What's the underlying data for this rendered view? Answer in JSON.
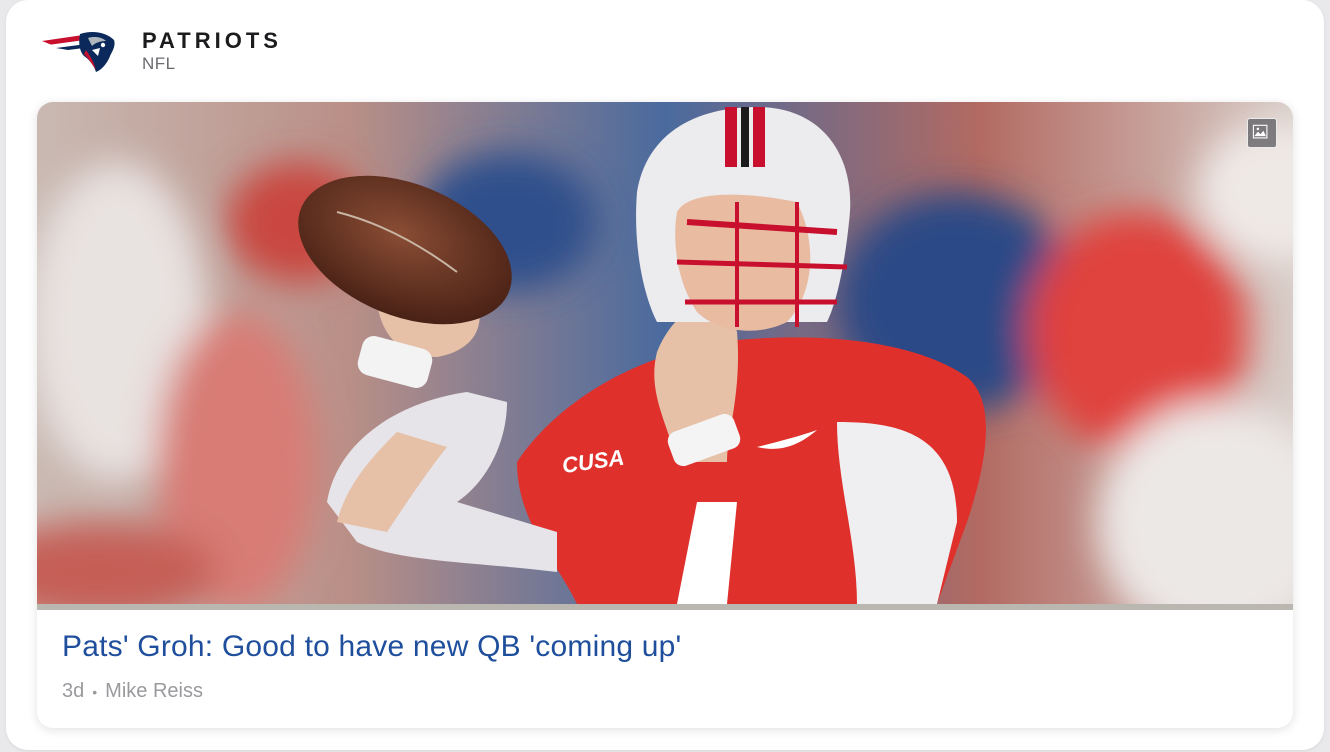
{
  "team": {
    "name": "PATRIOTS",
    "league": "NFL",
    "logo_icon": "patriots-flying-elvis-logo",
    "colors": {
      "navy": "#0b2a5b",
      "red": "#c8102e",
      "silver": "#b0b7bc"
    }
  },
  "article": {
    "headline": "Pats' Groh: Good to have new QB 'coming up'",
    "age": "3d",
    "separator": "•",
    "author": "Mike Reiss",
    "headline_color": "#1f4f9c",
    "image_badge_icon": "image-icon"
  }
}
